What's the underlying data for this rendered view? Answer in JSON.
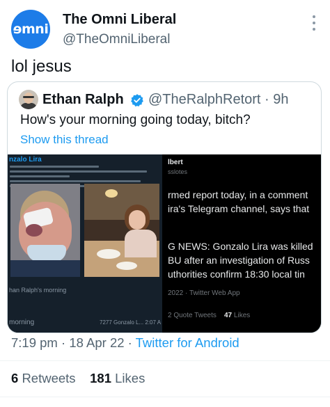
{
  "tweet": {
    "avatar_text": "ɘmni",
    "display_name": "The Omni Liberal",
    "handle": "@TheOmniLiberal",
    "text": "lol jesus",
    "time": "7:19 pm",
    "date": "18 Apr 22",
    "source": "Twitter for Android",
    "retweets": "6",
    "retweets_label": "Retweets",
    "likes": "181",
    "likes_label": "Likes"
  },
  "quote": {
    "display_name": "Ethan Ralph",
    "handle": "@TheRalphRetort",
    "age": "9h",
    "text": "How's your morning going today, bitch?",
    "show_thread": "Show this thread",
    "media_left": {
      "author": "nzalo Lira",
      "caption": "han Ralph's morning",
      "bottom": "morning",
      "views": "7277  Gonzalo L... 2:07 A"
    },
    "media_right": {
      "name": "lbert",
      "handle": "sslotes",
      "line1": "rmed report today, in a comment",
      "line2": "ira's Telegram channel, says that",
      "line3": "G NEWS: Gonzalo Lira was killed",
      "line4": "BU after an investigation of Russ",
      "line5": "uthorities confirm 18:30 local tin",
      "meta": "2022 · Twitter Web App",
      "quote_tweets_count": "2",
      "quote_tweets_label": "Quote Tweets",
      "likes_count": "47",
      "likes_label": "Likes"
    }
  },
  "colors": {
    "accent": "#1d9bf0",
    "avatar": "#1d7ce8",
    "secondary_text": "#536471"
  }
}
